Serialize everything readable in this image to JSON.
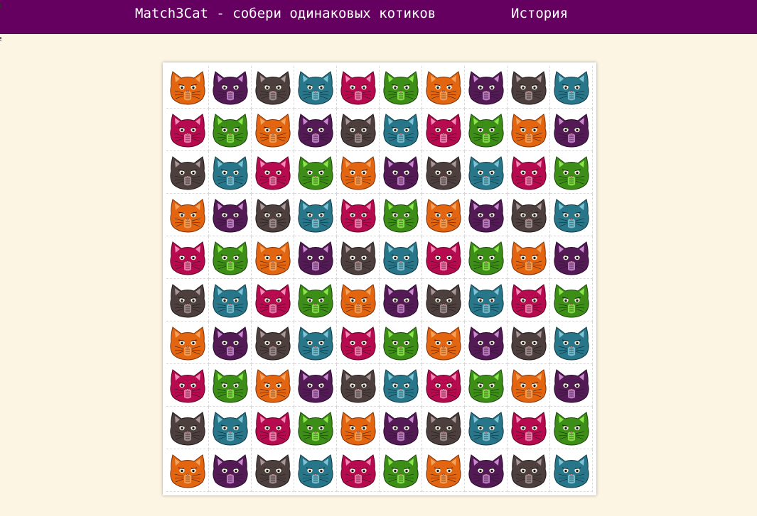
{
  "header": {
    "title": "Match3Cat - собери одинаковых котиков",
    "history_link": "История"
  },
  "palette": {
    "orange": {
      "body": "#e4650f",
      "inner": "#f3a25b",
      "stroke": "#7a3008"
    },
    "purple": {
      "body": "#531a55",
      "inner": "#c98ad0",
      "stroke": "#2a0b2c"
    },
    "brown": {
      "body": "#4d3f3e",
      "inner": "#a89796",
      "stroke": "#211918"
    },
    "teal": {
      "body": "#27768a",
      "inner": "#7fc4d4",
      "stroke": "#0f3a45"
    },
    "crimson": {
      "body": "#b80a4f",
      "inner": "#f08bb7",
      "stroke": "#5a0325"
    },
    "green": {
      "body": "#3d8e17",
      "inner": "#8be54c",
      "stroke": "#1b450a"
    }
  },
  "board": {
    "rows": 10,
    "cols": 10,
    "cells": [
      [
        "orange",
        "purple",
        "brown",
        "teal",
        "crimson",
        "green",
        "orange",
        "purple",
        "brown",
        "teal"
      ],
      [
        "crimson",
        "green",
        "orange",
        "purple",
        "brown",
        "teal",
        "crimson",
        "green",
        "orange",
        "purple"
      ],
      [
        "brown",
        "teal",
        "crimson",
        "green",
        "orange",
        "purple",
        "brown",
        "teal",
        "crimson",
        "green"
      ],
      [
        "orange",
        "purple",
        "brown",
        "teal",
        "crimson",
        "green",
        "orange",
        "purple",
        "brown",
        "teal"
      ],
      [
        "crimson",
        "green",
        "orange",
        "purple",
        "brown",
        "teal",
        "crimson",
        "green",
        "orange",
        "purple"
      ],
      [
        "brown",
        "teal",
        "crimson",
        "green",
        "orange",
        "purple",
        "brown",
        "teal",
        "crimson",
        "green"
      ],
      [
        "orange",
        "purple",
        "brown",
        "teal",
        "crimson",
        "green",
        "orange",
        "purple",
        "brown",
        "teal"
      ],
      [
        "crimson",
        "green",
        "orange",
        "purple",
        "brown",
        "teal",
        "crimson",
        "green",
        "orange",
        "purple"
      ],
      [
        "brown",
        "teal",
        "crimson",
        "green",
        "orange",
        "purple",
        "brown",
        "teal",
        "crimson",
        "green"
      ],
      [
        "orange",
        "purple",
        "brown",
        "teal",
        "crimson",
        "green",
        "orange",
        "purple",
        "brown",
        "teal"
      ]
    ]
  }
}
